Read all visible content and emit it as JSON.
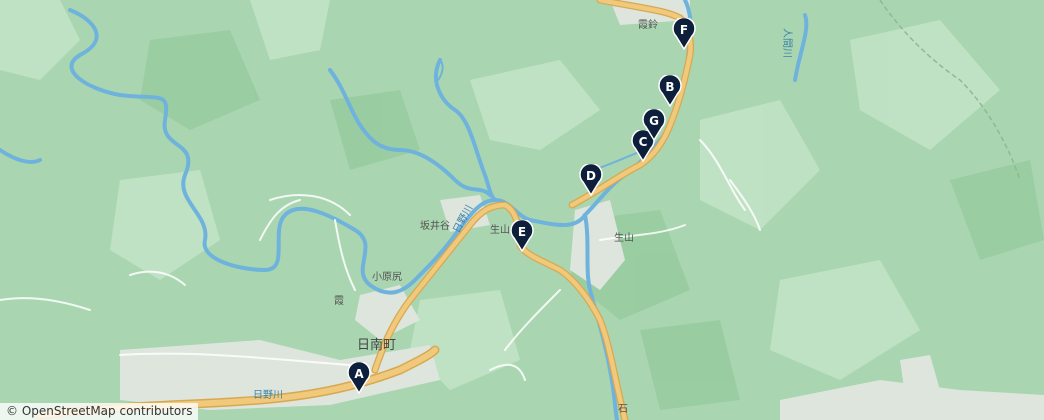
{
  "map": {
    "attribution": "© OpenStreetMap contributors",
    "colors": {
      "land": "#a9d6b0",
      "land_light": "#c4e4c8",
      "river": "#6fb3dd",
      "road": "#f0c97c",
      "road_outline": "#d8a850",
      "settlement": "#dfe6df",
      "marker": "#0d1f3a"
    },
    "places": {
      "hinan_cho": "日南町",
      "hino_gawa": "日野川",
      "sakaidani": "坂井谷",
      "kohara_jiri": "小原尻",
      "kasumi": "霞",
      "ikuyama_1": "生山",
      "ikuyama_2": "生山",
      "kiribi": "霞鈴",
      "ninen_gawa": "日野川",
      "iriai_gawa": "人間川",
      "ishi": "石"
    },
    "markers": [
      {
        "label": "A"
      },
      {
        "label": "B"
      },
      {
        "label": "C"
      },
      {
        "label": "D"
      },
      {
        "label": "E"
      },
      {
        "label": "F"
      },
      {
        "label": "G"
      }
    ]
  }
}
